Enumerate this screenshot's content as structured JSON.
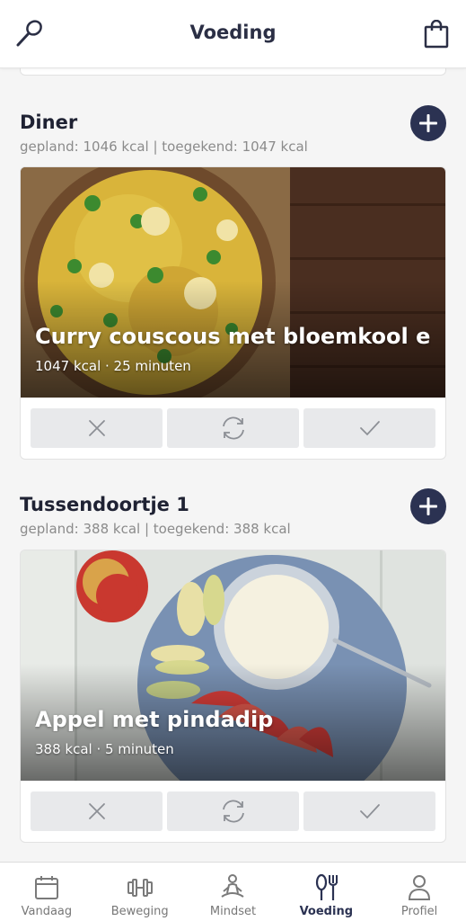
{
  "header": {
    "title": "Voeding",
    "left_icon": "whisk-icon",
    "right_icon": "shopping-bag-icon"
  },
  "meals": [
    {
      "title": "Diner",
      "summary": "gepland: 1046 kcal | toegekend: 1047 kcal",
      "recipe_name": "Curry couscous met bloemkool e...",
      "recipe_meta": "1047 kcal · 25 minuten",
      "actions": [
        "close-icon",
        "swap-icon",
        "check-icon"
      ]
    },
    {
      "title": "Tussendoortje 1",
      "summary": "gepland: 388 kcal | toegekend: 388 kcal",
      "recipe_name": "Appel met pindadip",
      "recipe_meta": "388 kcal · 5 minuten",
      "actions": [
        "close-icon",
        "swap-icon",
        "check-icon"
      ]
    }
  ],
  "nav": [
    {
      "label": "Vandaag",
      "icon": "calendar-icon"
    },
    {
      "label": "Beweging",
      "icon": "dumbbell-icon"
    },
    {
      "label": "Mindset",
      "icon": "meditation-icon"
    },
    {
      "label": "Voeding",
      "icon": "fork-spoon-icon",
      "active": true
    },
    {
      "label": "Profiel",
      "icon": "person-icon"
    }
  ],
  "colors": {
    "accent": "#2b3252",
    "button_bg": "#e8e9eb",
    "muted_text": "#8b8b8b"
  }
}
